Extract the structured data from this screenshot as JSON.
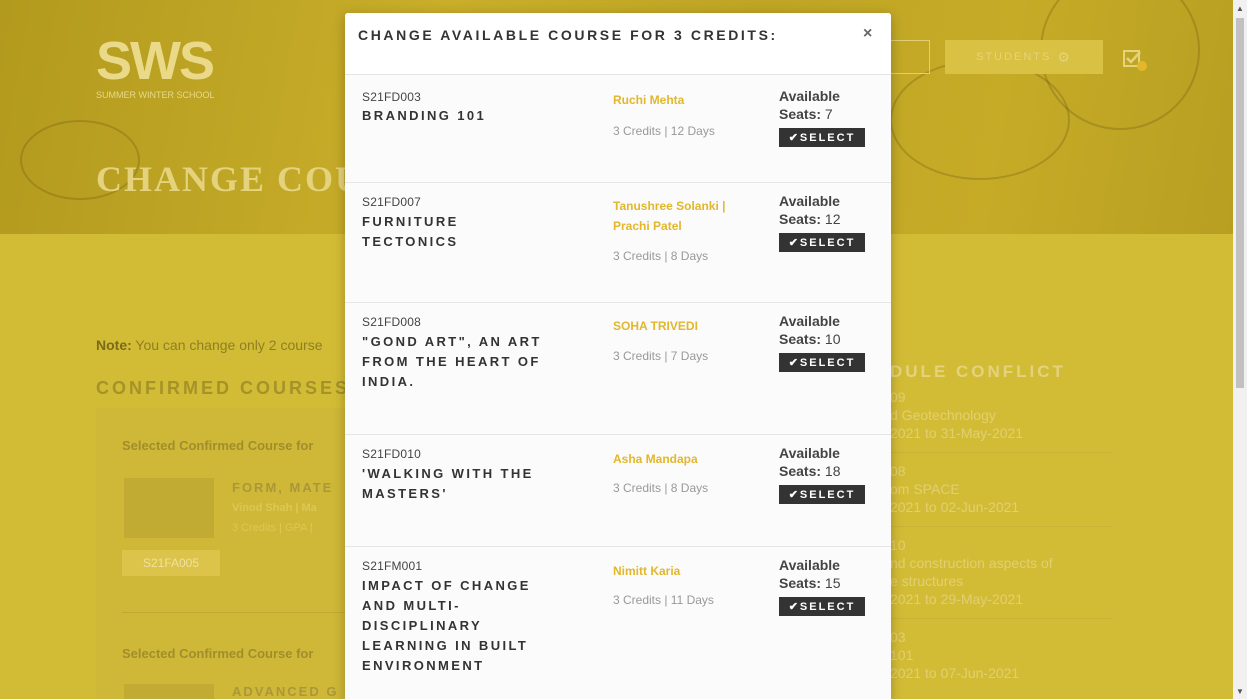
{
  "background": {
    "logo": "SWS",
    "logo_subtitle": "SUMMER WINTER SCHOOL",
    "nav": {
      "button1": "",
      "button2": "STUDENTS"
    },
    "page_heading": "CHANGE COU",
    "note_label": "Note:",
    "note_text": " You can change only 2 course",
    "confirmed_title": "CONFIRMED COURSES",
    "selected_label_1": "Selected Confirmed Course for",
    "selected_label_2": "Selected Confirmed Course for",
    "course1_title": "FORM, MATE",
    "course1_faculty": "Vinod Shah | Ma",
    "course1_meta": "3 Credits | GPA |",
    "course1_tag": "S21FA005",
    "course2_title": "ADVANCED G",
    "conflict_title": "DULE CONFLICT",
    "conflicts": [
      {
        "code": "09",
        "name": "d Geotechnology",
        "dates": "2021 to 31-May-2021"
      },
      {
        "code": "08",
        "name": "om SPACE",
        "dates": "2021 to 02-Jun-2021"
      },
      {
        "code": "10",
        "name": "nd construction aspects of",
        "name2": "e structures",
        "dates": "2021 to 29-May-2021"
      },
      {
        "code": "03",
        "name": "101",
        "dates": "2021 to 07-Jun-2021"
      }
    ]
  },
  "modal": {
    "title": "CHANGE AVAILABLE COURSE FOR 3 CREDITS:",
    "close": "×",
    "available_label": "Available",
    "seats_label": "Seats:",
    "select_label": "SELECT",
    "courses": [
      {
        "code": "S21FD003",
        "title": "BRANDING 101",
        "faculty": "Ruchi Mehta",
        "meta": "3 Credits | 12 Days",
        "seats": " 7"
      },
      {
        "code": "S21FD007",
        "title": "FURNITURE TECTONICS",
        "faculty": "Tanushree Solanki | Prachi Patel",
        "meta": "3 Credits | 8 Days",
        "seats": " 12"
      },
      {
        "code": "S21FD008",
        "title": "\"GOND ART\", AN ART FROM THE HEART OF INDIA.",
        "faculty": "SOHA TRIVEDI",
        "meta": "3 Credits | 7 Days",
        "seats": " 10"
      },
      {
        "code": "S21FD010",
        "title": "'WALKING WITH THE MASTERS'",
        "faculty": "Asha Mandapa",
        "meta": "3 Credits | 8 Days",
        "seats": " 18"
      },
      {
        "code": "S21FM001",
        "title": "IMPACT OF CHANGE AND MULTI-DISCIPLINARY LEARNING IN BUILT ENVIRONMENT",
        "faculty": "Nimitt Karia",
        "meta": "3 Credits | 11 Days",
        "seats": " 15"
      }
    ]
  }
}
